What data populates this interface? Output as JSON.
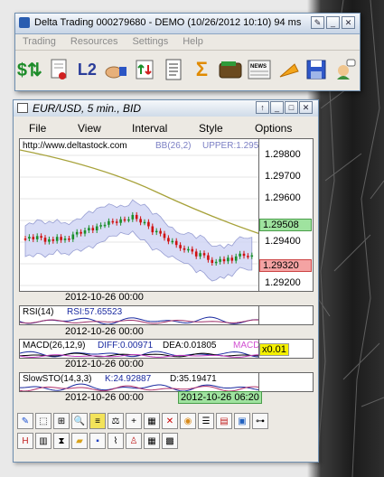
{
  "window": {
    "title": "Delta Trading 000279680 - DEMO (10/26/2012 10:10) 94 ms",
    "menu": [
      "Trading",
      "Resources",
      "Settings",
      "Help"
    ]
  },
  "toolbar": {
    "l2_label": "L2",
    "sigma_label": "Σ",
    "news_label": "NEWS",
    "icons": [
      "dollar-swap-icon",
      "report-icon",
      "l2-book-icon",
      "hand-order-icon",
      "arrows-chart-icon",
      "document-icon",
      "sigma-icon",
      "wallet-icon",
      "news-icon",
      "flag-icon",
      "save-icon",
      "user-chat-icon"
    ]
  },
  "chart_window": {
    "title": "EUR/USD, 5 min., BID",
    "menu": [
      "File",
      "View",
      "Interval",
      "Style",
      "Options"
    ]
  },
  "main_chart": {
    "url": "http://www.deltastock.com",
    "bb_label": "BB(26,2)",
    "upper_label": "UPPER:1.295:",
    "ticks": [
      "1.29800",
      "1.29700",
      "1.29600",
      "1.29400",
      "1.29200"
    ],
    "current_price": "1.29508",
    "cursor_price": "1.29320",
    "date_label": "2012-10-26 00:00",
    "colors": {
      "up": "#1a8f2a",
      "down": "#d01010",
      "ma": "#a7a23a",
      "band": "#cfd4f4",
      "band_line": "#7e86c8"
    }
  },
  "rsi": {
    "label": "RSI(14)",
    "value": "RSI:57.65523",
    "date_label": "2012-10-26 00:00"
  },
  "macd": {
    "label": "MACD(26,12,9)",
    "diff": "DIFF:0.00971",
    "dea": "DEA:0.01805",
    "macd_label": "MACD:",
    "value_badge": "x0.01",
    "date_label": "2012-10-26 00:00"
  },
  "slowsto": {
    "label": "SlowSTO(14,3,3)",
    "k": "K:24.92887",
    "d": "D:35.19471",
    "date_label": "2012-10-26 00:00",
    "cursor_time": "2012-10-26 06:20"
  },
  "bottom_toolbar": {
    "row1": [
      "pencil-icon",
      "cursor-box-icon",
      "crosshair-box-icon",
      "zoom-icon",
      "bars-yellow-icon",
      "scale-icon",
      "plus-icon",
      "grid-lines-icon",
      "delete-line-icon",
      "palette-icon",
      "list-icon",
      "color-bars-icon",
      "chart-picture-icon",
      "tree-icon"
    ],
    "row2": [
      "indicator-icon",
      "table-icon",
      "hourglass-icon",
      "folder-icon",
      "save-icon",
      "line-chart-icon",
      "people-icon",
      "calendar-icon",
      "calculator-icon"
    ]
  }
}
